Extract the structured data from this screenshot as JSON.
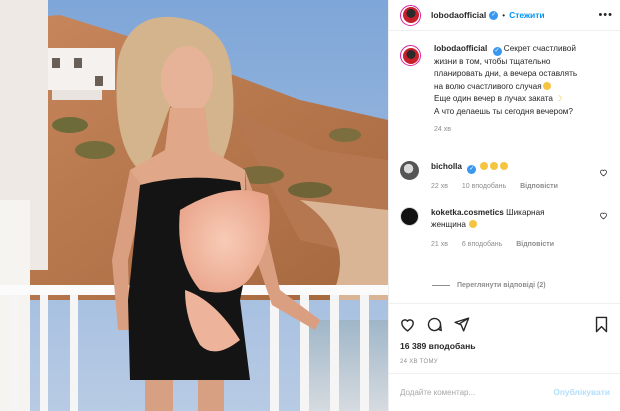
{
  "post": {
    "username": "lobodaofficial",
    "separator": "•",
    "follow_label": "Стежити",
    "caption_lines": [
      "Секрет счастливой",
      "жизни в том, чтобы тщательно",
      "планировать дни, а вечера оставлять",
      "на волю счастливого случая",
      "Еще один вечер в лучах заката",
      "А что делаешь ты сегодня вечером?"
    ],
    "caption_time": "24 хв"
  },
  "comments": [
    {
      "username": "bicholla",
      "text": "",
      "time": "22 хв",
      "likes": "10 вподобань",
      "reply": "Відповісти"
    },
    {
      "username": "koketka.cosmetics",
      "text": "Шикарная",
      "text2": "женщина",
      "time": "21 хв",
      "likes": "6 вподобань",
      "reply": "Відповісти",
      "view_replies": "Переглянути відповіді (2)"
    }
  ],
  "actions": {
    "likes_count": "16 389 вподобань",
    "posted_ago": "24 ХВ ТОМУ"
  },
  "add_comment": {
    "placeholder": "Додайте коментар...",
    "publish_label": "Опублікувати"
  },
  "colors": {
    "accent": "#0095f6",
    "verified": "#3897f0",
    "muted": "#8e8e8e",
    "publish_disabled": "#b2dffc"
  },
  "icons": [
    "more-icon",
    "verified-icon",
    "heart-icon",
    "comment-icon",
    "share-icon",
    "bookmark-icon"
  ]
}
